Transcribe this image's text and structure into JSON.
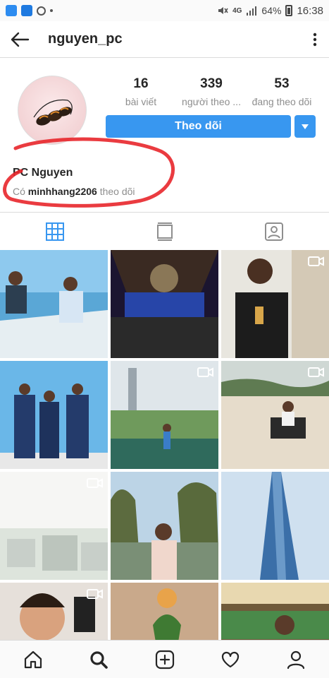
{
  "status_bar": {
    "network": "4G",
    "battery_percent": "64%",
    "time": "16:38"
  },
  "header": {
    "username": "nguyen_pc",
    "back_icon": "arrow-left-icon",
    "menu_icon": "more-vertical-icon"
  },
  "profile": {
    "stats": [
      {
        "value": "16",
        "label": "bài viết"
      },
      {
        "value": "339",
        "label": "người theo ..."
      },
      {
        "value": "53",
        "label": "đang theo dõi"
      }
    ],
    "follow_label": "Theo dõi",
    "display_name": "PC Nguyen",
    "followed_by_prefix": "Có",
    "followed_by_user": "minhhang2206",
    "followed_by_suffix": "theo dõi"
  },
  "tabs": [
    {
      "icon": "grid-icon",
      "active": true
    },
    {
      "icon": "feed-icon",
      "active": false
    },
    {
      "icon": "tagged-icon",
      "active": false
    }
  ],
  "colors": {
    "accent": "#3897f0",
    "annotation": "#e8262b"
  },
  "bottom_nav": [
    {
      "icon": "home-icon"
    },
    {
      "icon": "search-icon"
    },
    {
      "icon": "add-post-icon"
    },
    {
      "icon": "heart-icon"
    },
    {
      "icon": "profile-icon"
    }
  ]
}
